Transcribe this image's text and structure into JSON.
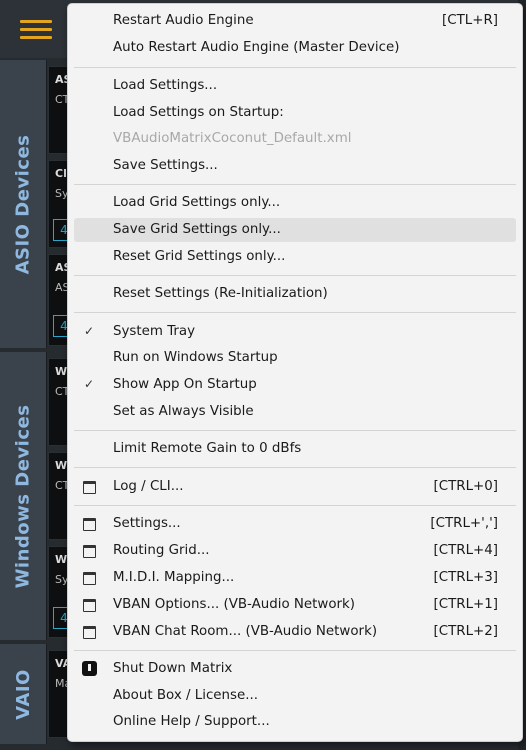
{
  "app": {
    "side_tabs": [
      "ASIO Devices",
      "Windows Devices",
      "VAIO"
    ],
    "card_texts": {
      "c1": [
        "AS",
        "CT"
      ],
      "c2": [
        "Cl",
        "Sy",
        "4"
      ],
      "c3": [
        "AS",
        "AS",
        "4"
      ],
      "c4": [
        "W",
        "CT"
      ],
      "c5": [
        "W",
        "CT"
      ],
      "c6": [
        "W",
        "Sy",
        "4"
      ],
      "c7": [
        "VA",
        "Ma"
      ]
    },
    "colors": {
      "accent": "#e3a51e",
      "tab_text": "#8fb8e0",
      "badge": "#29a6c9"
    }
  },
  "menu": {
    "restart_audio": {
      "label": "Restart Audio Engine",
      "shortcut": "[CTL+R]"
    },
    "auto_restart": {
      "label": "Auto Restart Audio Engine (Master Device)"
    },
    "load_settings": {
      "label": "Load Settings..."
    },
    "load_on_startup": {
      "label": "Load Settings on Startup:"
    },
    "startup_file": {
      "label": "VBAudioMatrixCoconut_Default.xml"
    },
    "save_settings": {
      "label": "Save Settings..."
    },
    "load_grid": {
      "label": "Load Grid Settings only..."
    },
    "save_grid": {
      "label": "Save Grid Settings only..."
    },
    "reset_grid": {
      "label": "Reset Grid Settings only..."
    },
    "reset_settings": {
      "label": "Reset Settings (Re-Initialization)"
    },
    "system_tray": {
      "label": "System Tray",
      "check": "✓"
    },
    "run_on_startup": {
      "label": "Run on Windows Startup"
    },
    "show_app": {
      "label": "Show App On Startup",
      "check": "✓"
    },
    "always_visible": {
      "label": "Set as Always Visible"
    },
    "limit_gain": {
      "label": "Limit Remote Gain to 0 dBfs"
    },
    "log_cli": {
      "label": "Log / CLI...",
      "shortcut": "[CTRL+0]"
    },
    "settings": {
      "label": "Settings...",
      "shortcut": "[CTRL+',']"
    },
    "routing_grid": {
      "label": "Routing Grid...",
      "shortcut": "[CTRL+4]"
    },
    "midi_mapping": {
      "label": "M.I.D.I. Mapping...",
      "shortcut": "[CTRL+3]"
    },
    "vban_options": {
      "label": "VBAN Options... (VB-Audio Network)",
      "shortcut": "[CTRL+1]"
    },
    "vban_chat": {
      "label": "VBAN Chat Room... (VB-Audio Network)",
      "shortcut": "[CTRL+2]"
    },
    "shutdown": {
      "label": "Shut Down Matrix"
    },
    "about": {
      "label": "About Box / License..."
    },
    "online_help": {
      "label": "Online Help / Support..."
    }
  }
}
